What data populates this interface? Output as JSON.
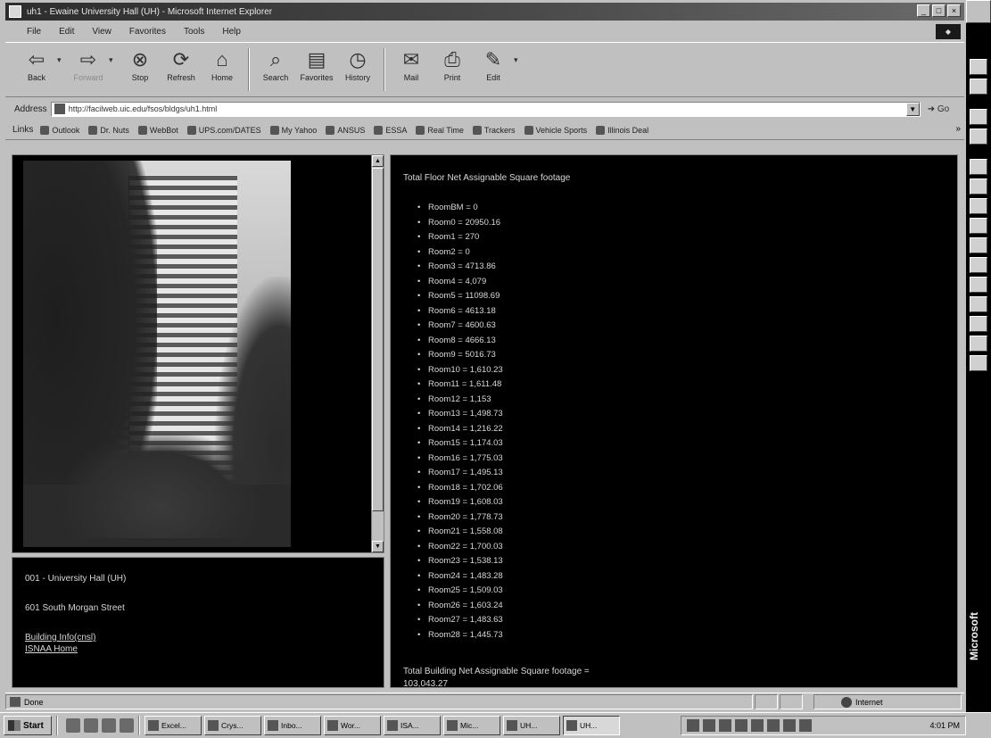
{
  "window": {
    "title": "uh1 - Ewaine University Hall (UH) - Microsoft Internet Explorer",
    "controls": [
      "_",
      "□",
      "×"
    ]
  },
  "menu": [
    "File",
    "Edit",
    "View",
    "Favorites",
    "Tools",
    "Help"
  ],
  "toolbar": {
    "back": "Back",
    "forward": "Forward",
    "stop": "Stop",
    "refresh": "Refresh",
    "home": "Home",
    "search": "Search",
    "favorites": "Favorites",
    "history": "History",
    "mail": "Mail",
    "print": "Print",
    "edit": "Edit"
  },
  "address": {
    "label": "Address",
    "url": "http://facilweb.uic.edu/fsos/bldgs/uh1.html",
    "go": "Go"
  },
  "links": {
    "label": "Links",
    "items": [
      "Outlook",
      "Dr. Nuts",
      "WebBot",
      "UPS.com/DATES",
      "My Yahoo",
      "ANSUS",
      "ESSA",
      "Real Time",
      "Trackers",
      "Vehicle Sports",
      "Illinois Deal"
    ]
  },
  "info": {
    "building": "001 - University Hall (UH)",
    "address": "601 South Morgan Street",
    "links": [
      "Building Info(cnsl)",
      "ISNAA Home"
    ]
  },
  "data": {
    "heading": "Total Floor Net Assignable Square footage",
    "floors": [
      "RoomBM = 0",
      "Room0 = 20950.16",
      "Room1 = 270",
      "Room2 = 0",
      "Room3 = 4713.86",
      "Room4 = 4,079",
      "Room5 = 11098.69",
      "Room6 = 4613.18",
      "Room7 = 4600.63",
      "Room8 = 4666.13",
      "Room9 = 5016.73",
      "Room10 = 1,610.23",
      "Room11 = 1,611.48",
      "Room12 = 1,153",
      "Room13 = 1,498.73",
      "Room14 = 1,216.22",
      "Room15 = 1,174.03",
      "Room16 = 1,775.03",
      "Room17 = 1,495.13",
      "Room18 = 1,702.06",
      "Room19 = 1,608.03",
      "Room20 = 1,778.73",
      "Room21 = 1,558.08",
      "Room22 = 1,700.03",
      "Room23 = 1,538.13",
      "Room24 = 1,483.28",
      "Room25 = 1,509.03",
      "Room26 = 1,603.24",
      "Room27 = 1,483.63",
      "Room28 = 1,445.73"
    ],
    "total_label": "Total Building Net Assignable Square footage =",
    "total_value": "103,043.27"
  },
  "status": {
    "text": "Done",
    "zone": "Internet"
  },
  "taskbar": {
    "start": "Start",
    "tasks": [
      "Excel...",
      "Crys...",
      "Inbo...",
      "Wor...",
      "ISA...",
      "Mic...",
      "UH...",
      "UH..."
    ],
    "clock": "4:01 PM"
  },
  "officebar": {
    "brand": "Microsoft"
  }
}
